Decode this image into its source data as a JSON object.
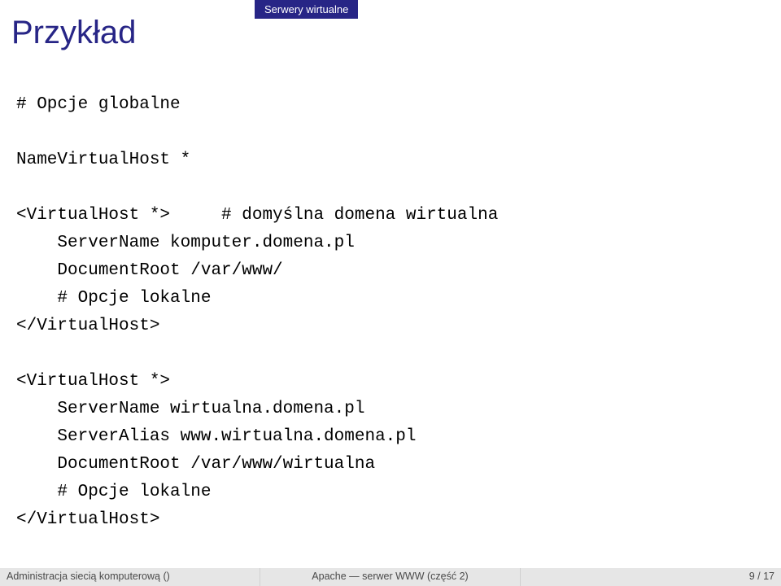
{
  "header": {
    "tab": "Serwery wirtualne",
    "title": "Przykład"
  },
  "code": {
    "line1": "# Opcje globalne",
    "line2": "",
    "line3": "NameVirtualHost *",
    "line4": "",
    "line5": "<VirtualHost *>     # domyślna domena wirtualna",
    "line6": "    ServerName komputer.domena.pl",
    "line7": "    DocumentRoot /var/www/",
    "line8": "    # Opcje lokalne",
    "line9": "</VirtualHost>",
    "line10": "",
    "line11": "<VirtualHost *>",
    "line12": "    ServerName wirtualna.domena.pl",
    "line13": "    ServerAlias www.wirtualna.domena.pl",
    "line14": "    DocumentRoot /var/www/wirtualna",
    "line15": "    # Opcje lokalne",
    "line16": "</VirtualHost>"
  },
  "footer": {
    "left": "Administracja siecią komputerową ()",
    "center": "Apache — serwer WWW (część 2)",
    "right": "9 / 17"
  }
}
